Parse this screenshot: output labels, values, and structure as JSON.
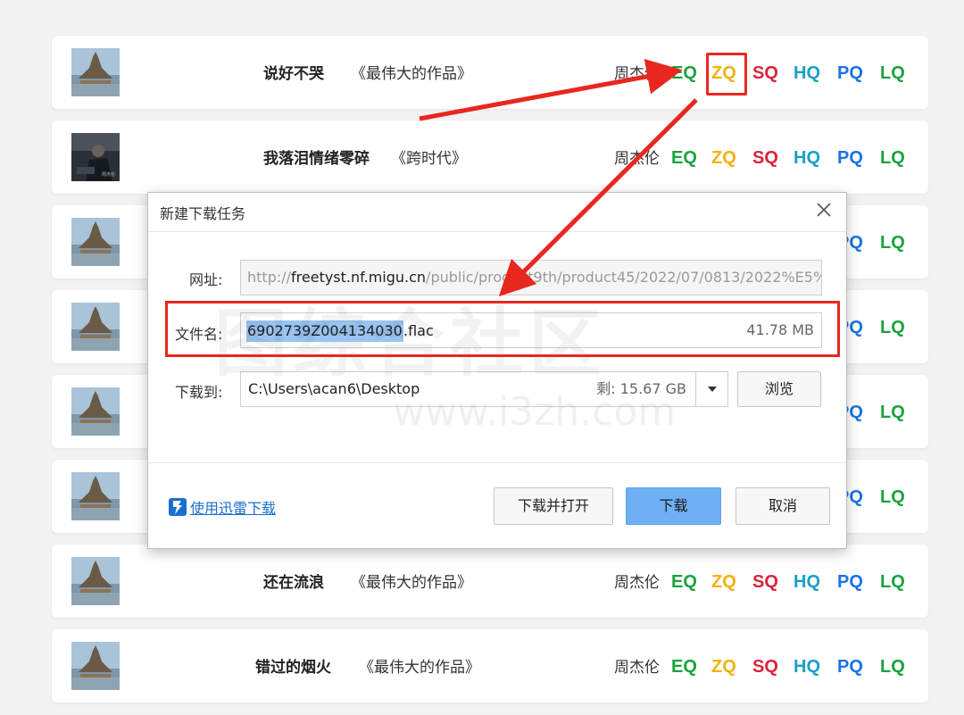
{
  "rows": [
    {
      "song": "说好不哭",
      "album": "《最伟大的作品》",
      "artist": "周杰伦"
    },
    {
      "song": "我落泪情绪零碎",
      "album": "《跨时代》",
      "artist": "周杰伦"
    },
    {
      "song": "",
      "album": "",
      "artist": ""
    },
    {
      "song": "",
      "album": "",
      "artist": ""
    },
    {
      "song": "",
      "album": "",
      "artist": ""
    },
    {
      "song": "",
      "album": "",
      "artist": ""
    },
    {
      "song": "还在流浪",
      "album": "《最伟大的作品》",
      "artist": "周杰伦"
    },
    {
      "song": "错过的烟火",
      "album": "《最伟大的作品》",
      "artist": "周杰伦"
    }
  ],
  "quality_labels": {
    "eq": "EQ",
    "zq": "ZQ",
    "sq": "SQ",
    "hq": "HQ",
    "pq": "PQ",
    "lq": "LQ"
  },
  "quality_colors": {
    "eq": "#1aa33d",
    "zq": "#f1b20e",
    "sq": "#d9243a",
    "hq": "#1a9fc4",
    "pq": "#1a73e8",
    "lq": "#1aa33d"
  },
  "dialog": {
    "title": "新建下载任务",
    "url_label": "网址:",
    "url_prefix": "http://",
    "url_host": "freetyst.nf.migu.cn",
    "url_path": "/public/product9th/product45/2022/07/0813/2022%E5%",
    "filename_label": "文件名:",
    "filename_selected": "6902739Z004134030",
    "filename_ext": ".flac",
    "file_size": "41.78 MB",
    "saveto_label": "下载到:",
    "save_path": "C:\\Users\\acan6\\Desktop",
    "free_space": "剩: 15.67 GB",
    "browse_label": "浏览",
    "thunder_label": "使用迅雷下载",
    "download_open_label": "下载并打开",
    "download_label": "下载",
    "cancel_label": "取消"
  },
  "watermark": {
    "cn": "图综合社区",
    "en": "www.i3zh.com"
  },
  "annotation_color": "#e8271f"
}
